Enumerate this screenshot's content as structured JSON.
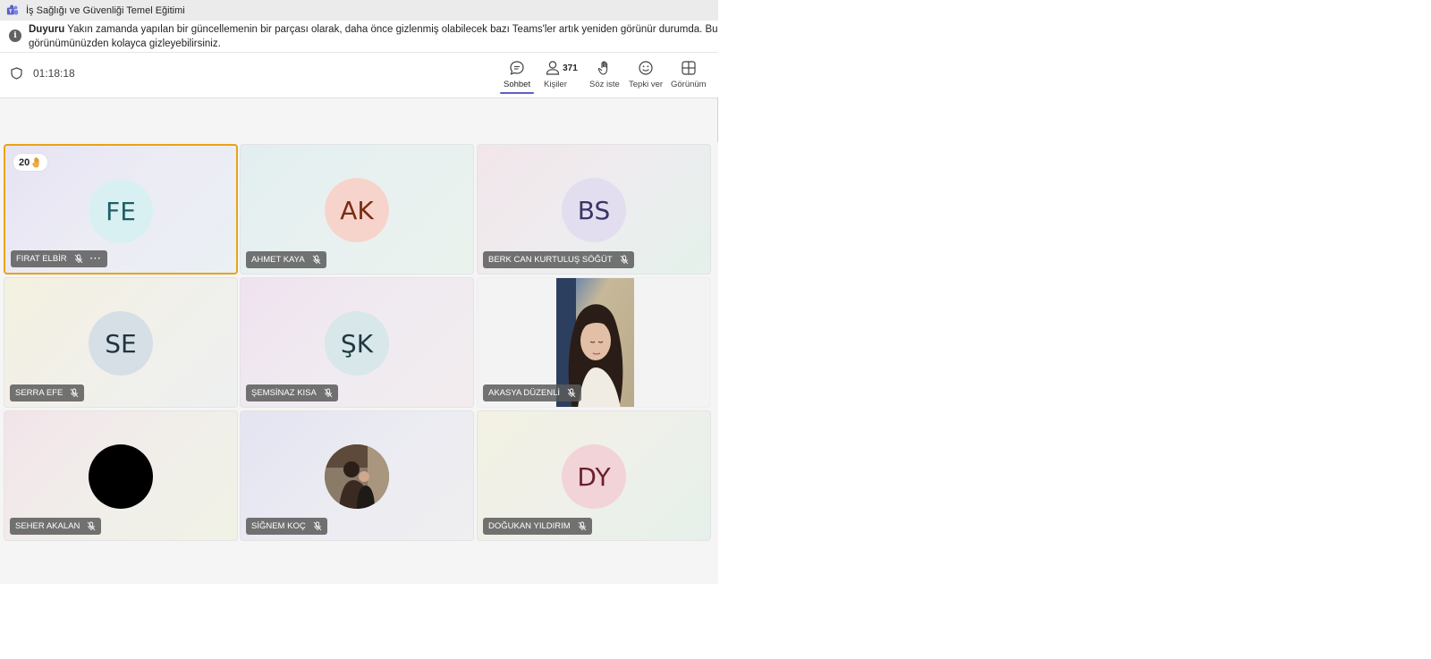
{
  "window": {
    "title": "İş Sağlığı ve Güvenliği Temel Eğitimi"
  },
  "notice": {
    "label": "Duyuru",
    "line1": "Yakın zamanda yapılan bir güncellemenin bir parçası olarak, daha önce gizlenmiş olabilecek bazı Teams'ler artık yeniden görünür durumda. Bu",
    "line2": "görünümünüzden kolayca gizleyebilirsiniz."
  },
  "toolbar": {
    "timer": "01:18:18",
    "chat": "Sohbet",
    "people": "Kişiler",
    "people_count": "371",
    "raise_hand": "Söz iste",
    "react": "Tepki ver",
    "view": "Görünüm"
  },
  "participants": [
    {
      "name": "FIRAT ELBİR",
      "initials": "FE",
      "avatar_bg": "#d9f0f3",
      "initials_color": "#1f5f66",
      "raised_hand_badge": "20"
    },
    {
      "name": "AHMET KAYA",
      "initials": "AK",
      "avatar_bg": "#f6d4cb",
      "initials_color": "#7a2b14"
    },
    {
      "name": "BERK CAN KURTULUŞ SÖĞÜT",
      "initials": "BS",
      "avatar_bg": "#e2deef",
      "initials_color": "#3b3566"
    },
    {
      "name": "SERRA EFE",
      "initials": "SE",
      "avatar_bg": "#d6dfe5",
      "initials_color": "#1f3340"
    },
    {
      "name": "ŞEMSİNAZ KISA",
      "initials": "ŞK",
      "avatar_bg": "#d8e7ea",
      "initials_color": "#1f3a40"
    },
    {
      "name": "AKASYA DÜZENLİ",
      "initials": ""
    },
    {
      "name": "SEHER AKALAN",
      "initials": ""
    },
    {
      "name": "SİĞNEM KOÇ",
      "initials": ""
    },
    {
      "name": "DOĞUKAN YILDIRIM",
      "initials": "DY",
      "avatar_bg": "#f1d3d8",
      "initials_color": "#6b1f2b"
    }
  ]
}
